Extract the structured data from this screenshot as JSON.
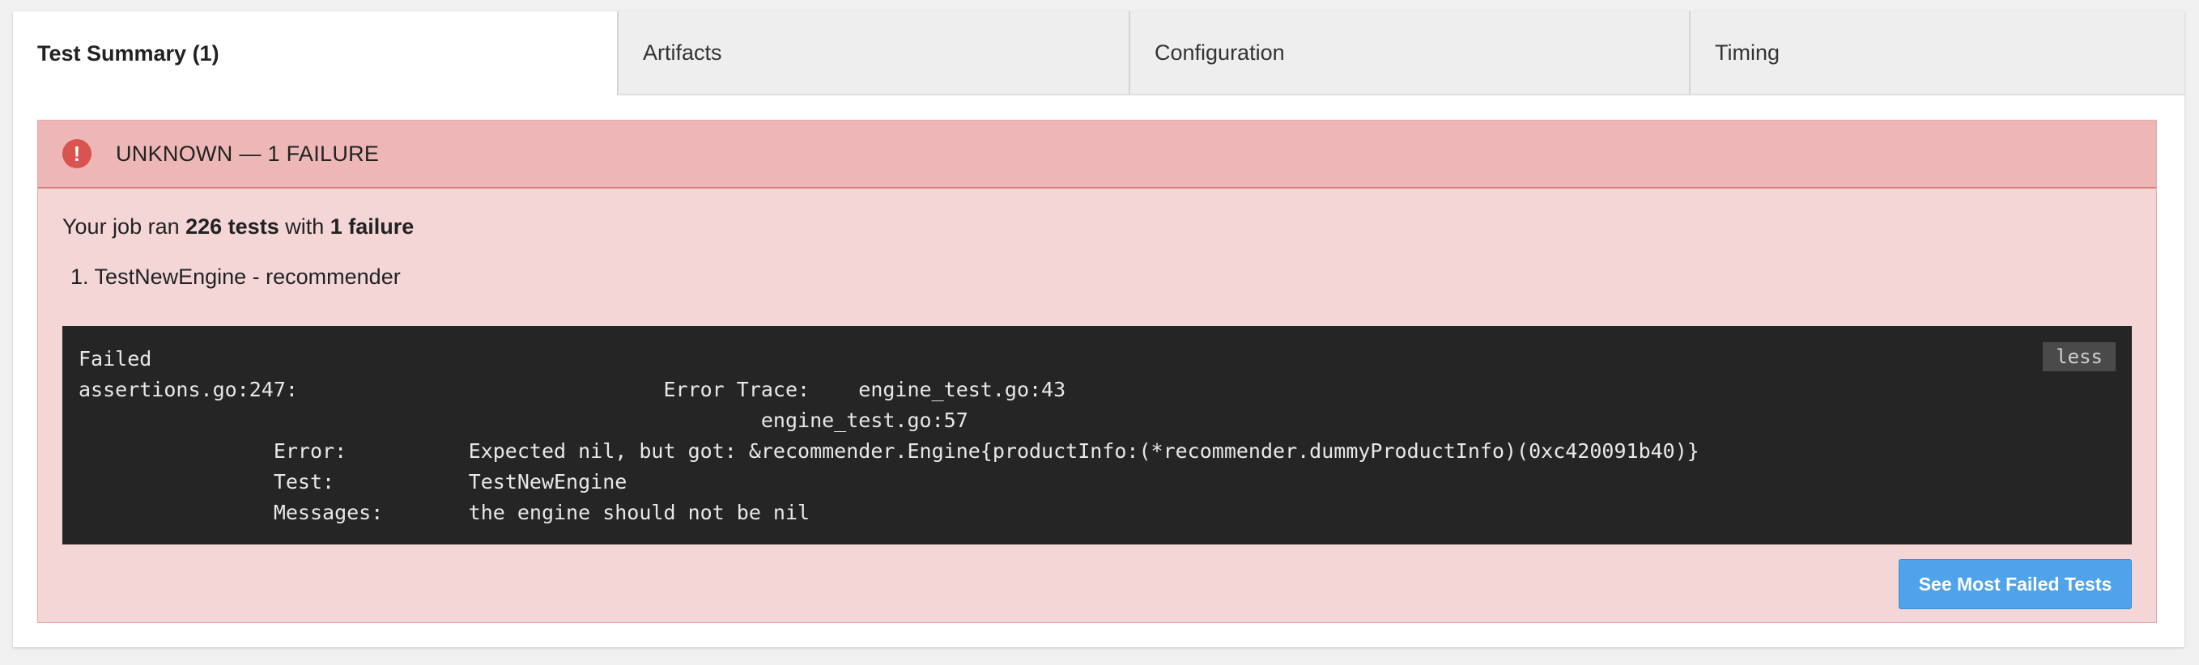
{
  "tabs": [
    {
      "label": "Test Summary (1)",
      "active": true
    },
    {
      "label": "Artifacts",
      "active": false
    },
    {
      "label": "Configuration",
      "active": false
    },
    {
      "label": "Timing",
      "active": false
    }
  ],
  "alert": {
    "icon": "alert-circle-icon",
    "icon_glyph": "!",
    "status": "UNKNOWN — 1 FAILURE",
    "color": "#d9534f"
  },
  "summary": {
    "prefix": "Your job ran ",
    "tests": "226 tests",
    "middle": " with ",
    "failures": "1 failure"
  },
  "failures": [
    {
      "number": "1.",
      "name": "TestNewEngine - recommender"
    }
  ],
  "output": {
    "lines": [
      "Failed",
      "assertions.go:247:                              Error Trace:    engine_test.go:43",
      "                                                        engine_test.go:57",
      "                Error:          Expected nil, but got: &recommender.Engine{productInfo:(*recommender.dummyProductInfo)(0xc420091b40)}",
      "                Test:           TestNewEngine",
      "                Messages:       the engine should not be nil"
    ],
    "toggle_label": "less"
  },
  "actions": {
    "most_failed_label": "See Most Failed Tests"
  }
}
